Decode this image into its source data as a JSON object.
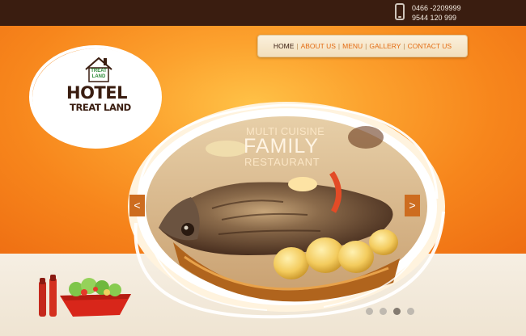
{
  "header": {
    "phone_icon": "mobile-phone-icon",
    "phone_numbers": [
      "0466 -2209999",
      "9544 120 999"
    ]
  },
  "nav": {
    "items": [
      {
        "label": "HOME",
        "active": true
      },
      {
        "label": "ABOUT US",
        "active": false
      },
      {
        "label": "MENU",
        "active": false
      },
      {
        "label": "GALLERY",
        "active": false
      },
      {
        "label": "CONTACT US",
        "active": false
      }
    ],
    "separator": "|"
  },
  "logo": {
    "badge_line1": "TREAT",
    "badge_line2": "LAND",
    "title": "HOTEL",
    "name": "TREAT LAND"
  },
  "slider": {
    "tagline_top": "MULTI CUISINE",
    "tagline_main": "FAMILY",
    "tagline_bottom": "RESTAURANT",
    "prev_label": "<",
    "next_label": ">",
    "slide_count": 4,
    "active_slide": 3
  },
  "colors": {
    "top_bar": "#3a1d10",
    "brand_orange": "#f7861c",
    "nav_link": "#e36b12",
    "nav_active": "#3a1d10",
    "logo_green": "#2b8a36"
  }
}
